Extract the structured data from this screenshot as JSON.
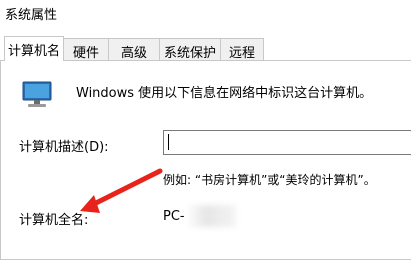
{
  "window": {
    "title": "系统属性"
  },
  "tabs": [
    {
      "label": "计算机名"
    },
    {
      "label": "硬件"
    },
    {
      "label": "高级"
    },
    {
      "label": "系统保护"
    },
    {
      "label": "远程"
    }
  ],
  "main": {
    "intro": "Windows 使用以下信息在网络中标识这台计算机。",
    "description_label": "计算机描述(D):",
    "description_value": "",
    "example": "例如: “书房计算机”或“美玲的计算机”。",
    "full_name_label": "计算机全名:",
    "full_name_value": "PC-"
  },
  "colors": {
    "annotation_arrow": "#e8231b"
  }
}
